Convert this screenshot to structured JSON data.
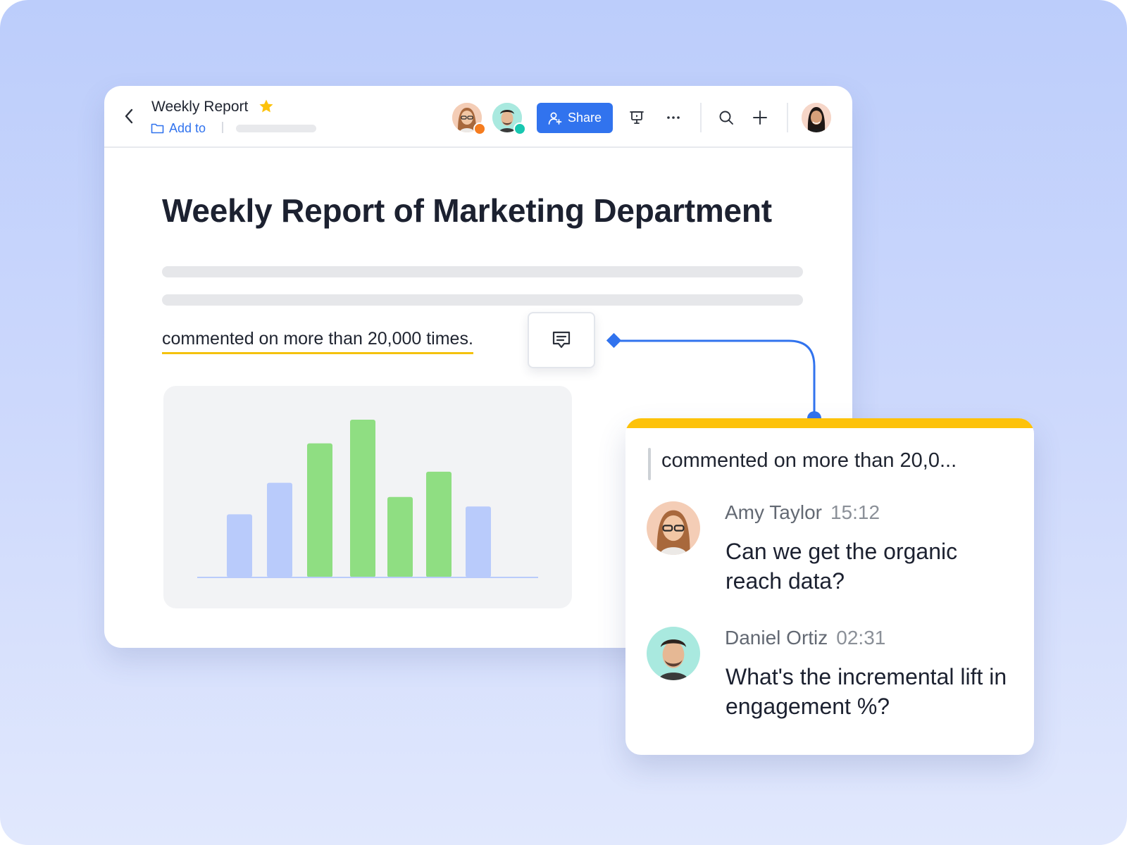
{
  "document": {
    "title": "Weekly Report",
    "add_to_label": "Add to",
    "heading": "Weekly Report of Marketing Department",
    "highlighted_text": "commented on more than 20,000 times."
  },
  "toolbar": {
    "share_label": "Share"
  },
  "chart_data": {
    "type": "bar",
    "values": [
      40,
      60,
      85,
      100,
      51,
      67,
      45
    ],
    "colors": [
      "#b9cbfb",
      "#b9cbfb",
      "#8fde82",
      "#8fde82",
      "#8fde82",
      "#8fde82",
      "#b9cbfb"
    ]
  },
  "comments_panel": {
    "quote": "commented on more than 20,0...",
    "comments": [
      {
        "author": "Amy Taylor",
        "time": "15:12",
        "message": "Can we get the organic reach data?"
      },
      {
        "author": "Daniel Ortiz",
        "time": "02:31",
        "message": "What's the incremental lift in engagement %?"
      }
    ]
  },
  "colors": {
    "accent": "#3173ee",
    "highlight": "#f4c20d",
    "panel_bar": "#fdc20a",
    "presence_orange": "#f57c1f",
    "presence_teal": "#18c7b0"
  }
}
